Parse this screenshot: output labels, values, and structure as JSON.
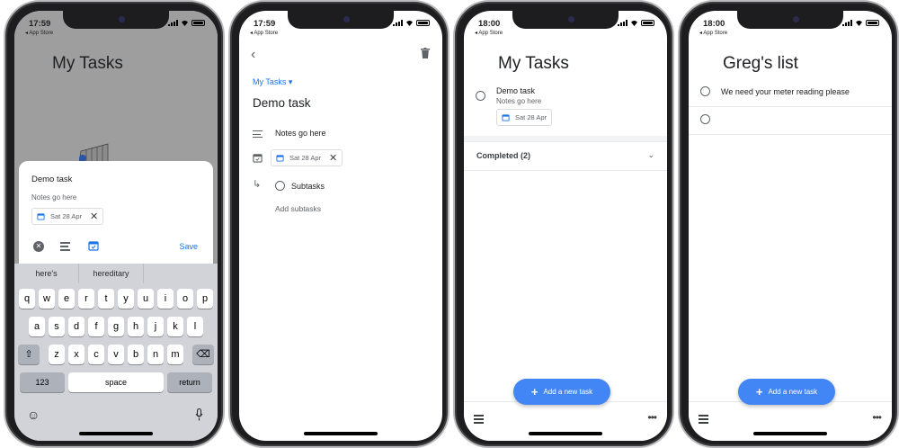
{
  "status_back_label": "◂ App Store",
  "phones": [
    {
      "time": "17:59"
    },
    {
      "time": "17:59"
    },
    {
      "time": "18:00"
    },
    {
      "time": "18:00"
    }
  ],
  "phone1": {
    "background_title": "My Tasks",
    "sheet": {
      "task_title": "Demo task",
      "notes_placeholder": "Notes go here",
      "date_chip": "Sat 28 Apr",
      "save_label": "Save"
    },
    "keyboard": {
      "suggestions": [
        "here's",
        "hereditary",
        ""
      ],
      "row1": [
        "q",
        "w",
        "e",
        "r",
        "t",
        "y",
        "u",
        "i",
        "o",
        "p"
      ],
      "row2": [
        "a",
        "s",
        "d",
        "f",
        "g",
        "h",
        "j",
        "k",
        "l"
      ],
      "row3": [
        "z",
        "x",
        "c",
        "v",
        "b",
        "n",
        "m"
      ],
      "numbers_label": "123",
      "space_label": "space",
      "return_label": "return"
    }
  },
  "phone2": {
    "list_selector": "My Tasks",
    "task_title": "Demo task",
    "notes": "Notes go here",
    "date_chip": "Sat 28 Apr",
    "subtasks_label": "Subtasks",
    "add_subtasks_label": "Add subtasks"
  },
  "phone3": {
    "list_title": "My Tasks",
    "task_title": "Demo task",
    "task_notes": "Notes go here",
    "date_chip": "Sat 28 Apr",
    "completed_label": "Completed (2)",
    "fab_label": "Add a new task"
  },
  "phone4": {
    "list_title": "Greg's list",
    "task1": "We need your meter reading please",
    "task2": "",
    "fab_label": "Add a new task"
  },
  "colors": {
    "accent": "#1a73e8",
    "fab": "#4285f4",
    "dim_overlay": "#9e9e9e"
  }
}
